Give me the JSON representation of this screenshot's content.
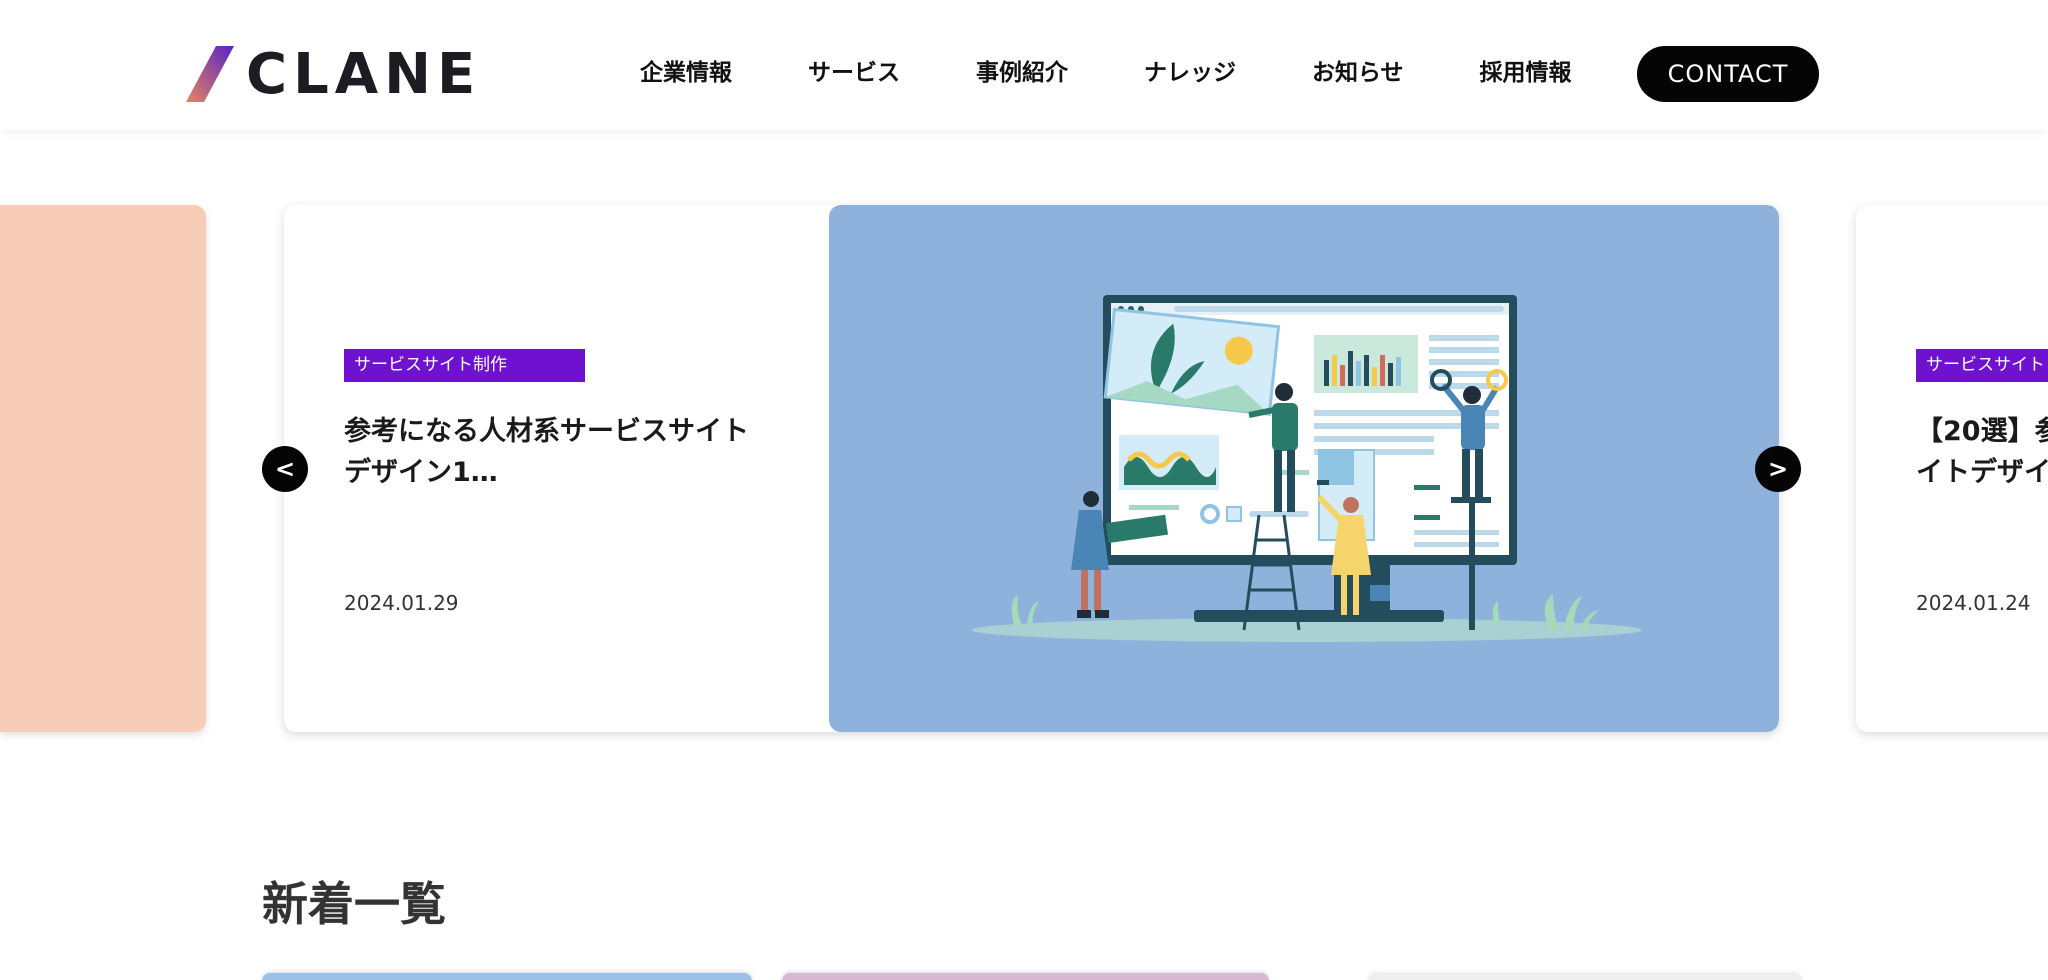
{
  "brand": {
    "name": "CLANE"
  },
  "nav": {
    "items": [
      "企業情報",
      "サービス",
      "事例紹介",
      "ナレッジ",
      "お知らせ",
      "採用情報"
    ],
    "contact_label": "CONTACT"
  },
  "carousel": {
    "prev_label": "<",
    "next_label": ">",
    "current": {
      "tag": "サービスサイト制作",
      "title": "参考になる人材系サービスサイトデザイン1…",
      "date": "2024.01.29"
    },
    "next_peek": {
      "tag": "サービスサイト",
      "title": "【20選】参\nイトデザイ",
      "date": "2024.01.24"
    }
  },
  "section": {
    "title": "新着一覧"
  },
  "colors": {
    "tag_bg": "#6f12cf",
    "image_bg": "#8fb2dd",
    "peach": "#f7cdb8"
  }
}
